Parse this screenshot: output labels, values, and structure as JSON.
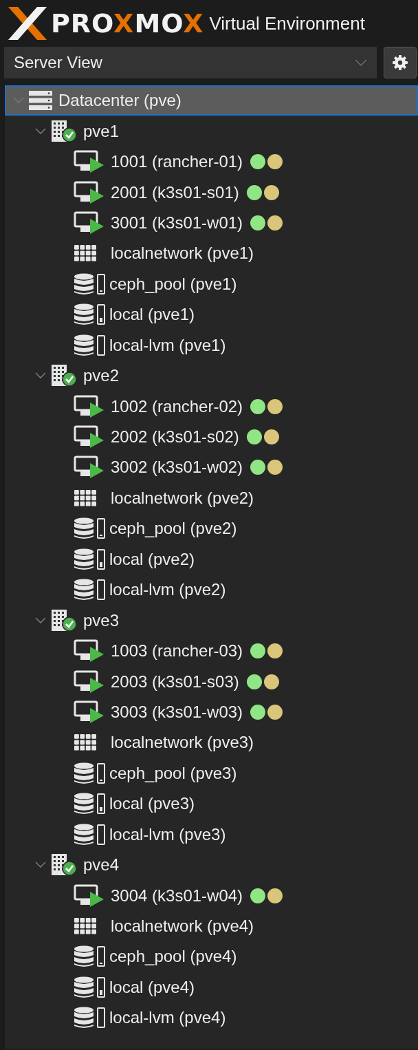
{
  "header": {
    "logo_parts": [
      {
        "text": "PRO",
        "accent": false
      },
      {
        "text": "X",
        "accent": true
      },
      {
        "text": "MO",
        "accent": false
      },
      {
        "text": "X",
        "accent": true
      }
    ],
    "title": "Virtual Environment"
  },
  "view_selector": {
    "value": "Server View"
  },
  "tree": {
    "label": "Datacenter (pve)",
    "kind": "datacenter",
    "expanded": true,
    "selected": true,
    "children": [
      {
        "label": "pve1",
        "kind": "node",
        "expanded": true,
        "selected": false,
        "children": [
          {
            "label": "1001 (rancher-01)",
            "kind": "vm",
            "selected": false,
            "tags": [
              {
                "color": "#90e684"
              },
              {
                "color": "#d9c67a"
              }
            ]
          },
          {
            "label": "2001 (k3s01-s01)",
            "kind": "vm",
            "selected": false,
            "tags": [
              {
                "color": "#90e684"
              },
              {
                "color": "#d9c67a"
              }
            ]
          },
          {
            "label": "3001 (k3s01-w01)",
            "kind": "vm",
            "selected": false,
            "tags": [
              {
                "color": "#90e684"
              },
              {
                "color": "#d9c67a"
              }
            ]
          },
          {
            "label": "localnetwork (pve1)",
            "kind": "network",
            "selected": false
          },
          {
            "label": "ceph_pool (pve1)",
            "kind": "storage",
            "selected": false,
            "level": 0.1
          },
          {
            "label": "local (pve1)",
            "kind": "storage",
            "selected": false,
            "level": 0.3
          },
          {
            "label": "local-lvm (pve1)",
            "kind": "storage",
            "selected": false
          }
        ]
      },
      {
        "label": "pve2",
        "kind": "node",
        "expanded": true,
        "selected": false,
        "children": [
          {
            "label": "1002 (rancher-02)",
            "kind": "vm",
            "selected": false,
            "tags": [
              {
                "color": "#90e684"
              },
              {
                "color": "#d9c67a"
              }
            ]
          },
          {
            "label": "2002 (k3s01-s02)",
            "kind": "vm",
            "selected": false,
            "tags": [
              {
                "color": "#90e684"
              },
              {
                "color": "#d9c67a"
              }
            ]
          },
          {
            "label": "3002 (k3s01-w02)",
            "kind": "vm",
            "selected": false,
            "tags": [
              {
                "color": "#90e684"
              },
              {
                "color": "#d9c67a"
              }
            ]
          },
          {
            "label": "localnetwork (pve2)",
            "kind": "network",
            "selected": false
          },
          {
            "label": "ceph_pool (pve2)",
            "kind": "storage",
            "selected": false,
            "level": 0.1
          },
          {
            "label": "local (pve2)",
            "kind": "storage",
            "selected": false,
            "level": 0.3
          },
          {
            "label": "local-lvm (pve2)",
            "kind": "storage",
            "selected": false
          }
        ]
      },
      {
        "label": "pve3",
        "kind": "node",
        "expanded": true,
        "selected": false,
        "children": [
          {
            "label": "1003 (rancher-03)",
            "kind": "vm",
            "selected": false,
            "tags": [
              {
                "color": "#90e684"
              },
              {
                "color": "#d9c67a"
              }
            ]
          },
          {
            "label": "2003 (k3s01-s03)",
            "kind": "vm",
            "selected": false,
            "tags": [
              {
                "color": "#90e684"
              },
              {
                "color": "#d9c67a"
              }
            ]
          },
          {
            "label": "3003 (k3s01-w03)",
            "kind": "vm",
            "selected": false,
            "tags": [
              {
                "color": "#90e684"
              },
              {
                "color": "#d9c67a"
              }
            ]
          },
          {
            "label": "localnetwork (pve3)",
            "kind": "network",
            "selected": false
          },
          {
            "label": "ceph_pool (pve3)",
            "kind": "storage",
            "selected": false,
            "level": 0.1
          },
          {
            "label": "local (pve3)",
            "kind": "storage",
            "selected": false,
            "level": 0.3
          },
          {
            "label": "local-lvm (pve3)",
            "kind": "storage",
            "selected": false
          }
        ]
      },
      {
        "label": "pve4",
        "kind": "node",
        "expanded": true,
        "selected": false,
        "children": [
          {
            "label": "3004 (k3s01-w04)",
            "kind": "vm",
            "selected": false,
            "tags": [
              {
                "color": "#90e684"
              },
              {
                "color": "#d9c67a"
              }
            ]
          },
          {
            "label": "localnetwork (pve4)",
            "kind": "network",
            "selected": false
          },
          {
            "label": "ceph_pool (pve4)",
            "kind": "storage",
            "selected": false,
            "level": 0.1
          },
          {
            "label": "local (pve4)",
            "kind": "storage",
            "selected": false,
            "level": 0.3
          },
          {
            "label": "local-lvm (pve4)",
            "kind": "storage",
            "selected": false
          }
        ]
      }
    ]
  }
}
